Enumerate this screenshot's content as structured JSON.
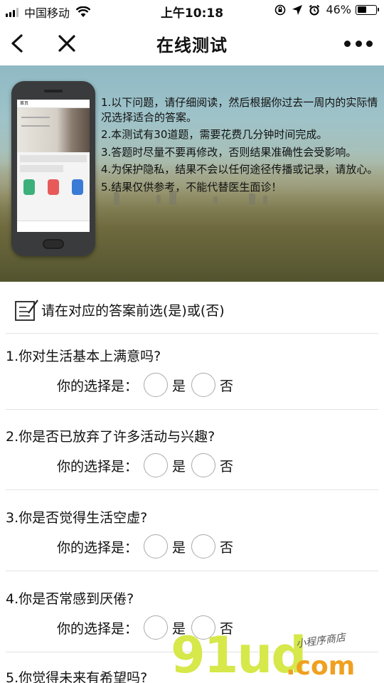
{
  "status_bar": {
    "carrier": "中国移动",
    "time": "上午10:18",
    "battery": "46%",
    "battery_level": 0.46
  },
  "nav": {
    "title": "在线测试"
  },
  "banner": {
    "phone_screen_title": "首页",
    "lines": [
      "1.以下问题，请仔细阅读，然后根据你过去一周内的实际情况选择适合的答案。",
      "2.本测试有30道题，需要花费几分钟时间完成。",
      "3.答题时尽量不要再修改，否则结果准确性会受影响。",
      "4.为保护隐私，结果不会以任何途径传播或记录，请放心。",
      "5.结果仅供参考，不能代替医生面诊！"
    ]
  },
  "instruction": "请在对应的答案前选(是)或(否)",
  "choice_label": "你的选择是：",
  "yes_label": "是",
  "no_label": "否",
  "questions": [
    "1.你对生活基本上满意吗?",
    "2.你是否已放弃了许多活动与兴趣?",
    "3.你是否觉得生活空虚?",
    "4.你是否常感到厌倦?",
    "5.你觉得未来有希望吗?"
  ],
  "watermark": {
    "main": "91ud",
    "com": ".com",
    "slogan": "小程序商店"
  }
}
